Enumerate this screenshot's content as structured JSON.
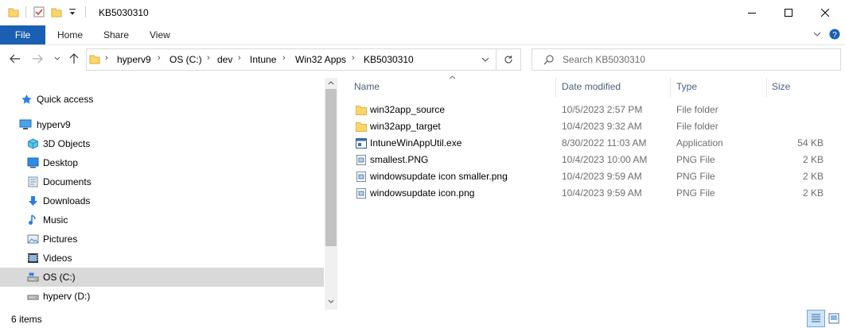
{
  "window": {
    "title": "KB5030310"
  },
  "ribbon": {
    "tabs": [
      "File",
      "Home",
      "Share",
      "View"
    ]
  },
  "address": {
    "crumbs": [
      "hyperv9",
      "OS (C:)",
      "dev",
      "Intune",
      "Win32 Apps",
      "KB5030310"
    ]
  },
  "search": {
    "placeholder": "Search KB5030310"
  },
  "nav": {
    "items": [
      {
        "label": "Quick access",
        "icon": "star-icon"
      },
      {
        "label": "hyperv9",
        "icon": "computer-icon"
      },
      {
        "label": "3D Objects",
        "icon": "cube-icon"
      },
      {
        "label": "Desktop",
        "icon": "desktop-icon"
      },
      {
        "label": "Documents",
        "icon": "documents-icon"
      },
      {
        "label": "Downloads",
        "icon": "download-icon"
      },
      {
        "label": "Music",
        "icon": "music-icon"
      },
      {
        "label": "Pictures",
        "icon": "pictures-icon"
      },
      {
        "label": "Videos",
        "icon": "videos-icon"
      },
      {
        "label": "OS (C:)",
        "icon": "drive-icon",
        "selected": true
      },
      {
        "label": "hyperv (D:)",
        "icon": "drive-icon"
      }
    ]
  },
  "columns": {
    "name": "Name",
    "date": "Date modified",
    "type": "Type",
    "size": "Size"
  },
  "files": [
    {
      "name": "win32app_source",
      "date": "10/5/2023 2:57 PM",
      "type": "File folder",
      "size": "",
      "icon": "folder-icon"
    },
    {
      "name": "win32app_target",
      "date": "10/4/2023 9:32 AM",
      "type": "File folder",
      "size": "",
      "icon": "folder-icon"
    },
    {
      "name": "IntuneWinAppUtil.exe",
      "date": "8/30/2022 11:03 AM",
      "type": "Application",
      "size": "54 KB",
      "icon": "app-icon"
    },
    {
      "name": "smallest.PNG",
      "date": "10/4/2023 10:00 AM",
      "type": "PNG File",
      "size": "2 KB",
      "icon": "image-file-icon"
    },
    {
      "name": "windowsupdate icon smaller.png",
      "date": "10/4/2023 9:59 AM",
      "type": "PNG File",
      "size": "2 KB",
      "icon": "image-file-icon"
    },
    {
      "name": "windowsupdate icon.png",
      "date": "10/4/2023 9:59 AM",
      "type": "PNG File",
      "size": "2 KB",
      "icon": "image-file-icon"
    }
  ],
  "status": {
    "count": "6 items"
  },
  "colors": {
    "accent": "#1a5fb4",
    "folder": "#ffd766",
    "selected_row": "#d9d9d9"
  }
}
